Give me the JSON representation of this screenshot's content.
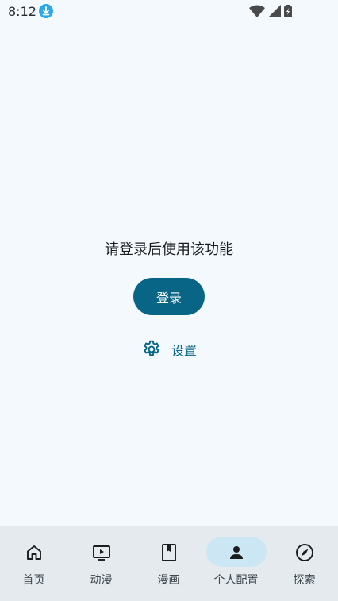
{
  "status_bar": {
    "time": "8:12",
    "icons": [
      "download-icon",
      "wifi-icon",
      "signal-icon",
      "battery-icon"
    ]
  },
  "main": {
    "prompt": "请登录后使用该功能",
    "login_label": "登录",
    "settings_label": "设置"
  },
  "bottom_nav": {
    "items": [
      {
        "label": "首页",
        "icon": "home-icon",
        "active": false
      },
      {
        "label": "动漫",
        "icon": "play-tv-icon",
        "active": false
      },
      {
        "label": "漫画",
        "icon": "book-icon",
        "active": false
      },
      {
        "label": "个人配置",
        "icon": "person-icon",
        "active": true
      },
      {
        "label": "探索",
        "icon": "compass-icon",
        "active": false
      }
    ]
  },
  "colors": {
    "background": "#f3f9fd",
    "accent": "#086585",
    "nav_background": "#e4eaee",
    "nav_active_pill": "#cde6f4"
  }
}
